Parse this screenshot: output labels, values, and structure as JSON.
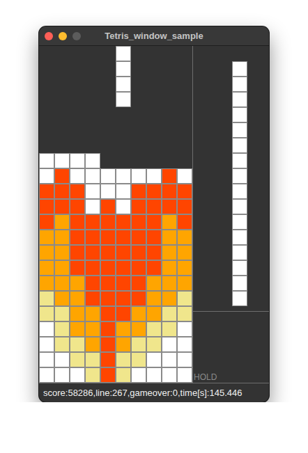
{
  "window": {
    "title": "Tetris_window_sample",
    "buttons": [
      {
        "kind": "close",
        "color": "#ff5f57"
      },
      {
        "kind": "minimize",
        "color": "#febc2e"
      },
      {
        "kind": "zoom",
        "color": "#5c5c5c"
      }
    ]
  },
  "board": {
    "rows": [
      [
        null,
        null,
        null,
        null,
        null,
        "#ffffff",
        null,
        null,
        null,
        null
      ],
      [
        null,
        null,
        null,
        null,
        null,
        "#ffffff",
        null,
        null,
        null,
        null
      ],
      [
        null,
        null,
        null,
        null,
        null,
        "#ffffff",
        null,
        null,
        null,
        null
      ],
      [
        null,
        null,
        null,
        null,
        null,
        "#ffffff",
        null,
        null,
        null,
        null
      ],
      [
        null,
        null,
        null,
        null,
        null,
        null,
        null,
        null,
        null,
        null
      ],
      [
        null,
        null,
        null,
        null,
        null,
        null,
        null,
        null,
        null,
        null
      ],
      [
        null,
        null,
        null,
        null,
        null,
        null,
        null,
        null,
        null,
        null
      ],
      [
        "#ffffff",
        "#ffffff",
        "#ffffff",
        "#ffffff",
        null,
        null,
        null,
        null,
        null,
        null
      ],
      [
        "#ffffff",
        "#ff4500",
        "#ffffff",
        "#ffffff",
        "#ffffff",
        "#ffffff",
        "#ffffff",
        "#ffffff",
        "#ff4500",
        "#ffffff"
      ],
      [
        "#ff4500",
        "#ff4500",
        "#ff4500",
        "#ffffff",
        "#ffffff",
        "#ffffff",
        "#ff4500",
        "#ff4500",
        "#ff4500",
        "#ff4500"
      ],
      [
        "#ff4500",
        "#ff4500",
        "#ff4500",
        "#ffffff",
        "#ff4500",
        "#ffffff",
        "#ff4500",
        "#ff4500",
        "#ff4500",
        "#ff4500"
      ],
      [
        "#ff4500",
        "#ffa500",
        "#ff4500",
        "#ff4500",
        "#ff4500",
        "#ff4500",
        "#ff4500",
        "#ff4500",
        "#ffa500",
        "#ff4500"
      ],
      [
        "#ffa500",
        "#ffa500",
        "#ff4500",
        "#ff4500",
        "#ff4500",
        "#ff4500",
        "#ff4500",
        "#ff4500",
        "#ffa500",
        "#ffa500"
      ],
      [
        "#ffa500",
        "#ffa500",
        "#ff4500",
        "#ff4500",
        "#ff4500",
        "#ff4500",
        "#ff4500",
        "#ff4500",
        "#ffa500",
        "#ffa500"
      ],
      [
        "#ffa500",
        "#ffa500",
        "#ff4500",
        "#ff4500",
        "#ff4500",
        "#ff4500",
        "#ff4500",
        "#ff4500",
        "#ffa500",
        "#ffa500"
      ],
      [
        "#ffa500",
        "#ffa500",
        "#ffa500",
        "#ff4500",
        "#ff4500",
        "#ff4500",
        "#ff4500",
        "#ffa500",
        "#ffa500",
        "#ffa500"
      ],
      [
        "#f0e68c",
        "#ffa500",
        "#ffa500",
        "#ff4500",
        "#ff4500",
        "#ff4500",
        "#ff4500",
        "#ffa500",
        "#ffa500",
        "#f0e68c"
      ],
      [
        "#f0e68c",
        "#f0e68c",
        "#ffa500",
        "#ffa500",
        "#ff4500",
        "#ff4500",
        "#ffa500",
        "#ffa500",
        "#f0e68c",
        "#f0e68c"
      ],
      [
        "#ffffff",
        "#f0e68c",
        "#ffa500",
        "#ffa500",
        "#ff4500",
        "#ffa500",
        "#ffa500",
        "#f0e68c",
        "#f0e68c",
        "#ffffff"
      ],
      [
        "#ffffff",
        "#f0e68c",
        "#f0e68c",
        "#ffa500",
        "#ff4500",
        "#ffa500",
        "#f0e68c",
        "#f0e68c",
        "#ffffff",
        "#ffffff"
      ],
      [
        "#ffffff",
        "#ffffff",
        "#f0e68c",
        "#f0e68c",
        "#ff4500",
        "#f0e68c",
        "#f0e68c",
        "#ffffff",
        "#ffffff",
        "#ffffff"
      ],
      [
        "#ffffff",
        "#ffffff",
        "#ffffff",
        "#f0e68c",
        "#ff4500",
        "#f0e68c",
        "#ffffff",
        "#ffffff",
        "#ffffff",
        "#ffffff"
      ]
    ]
  },
  "next": [
    {
      "color": "#ffffff",
      "cells": 4
    },
    {
      "color": "#ffffff",
      "cells": 4
    },
    {
      "color": "#ffffff",
      "cells": 4
    },
    {
      "color": "#ffffff",
      "cells": 4
    }
  ],
  "hold": {
    "label": "HOLD"
  },
  "status_bar": "score:58286,line:267,gameover:0,time[s]:145.446"
}
